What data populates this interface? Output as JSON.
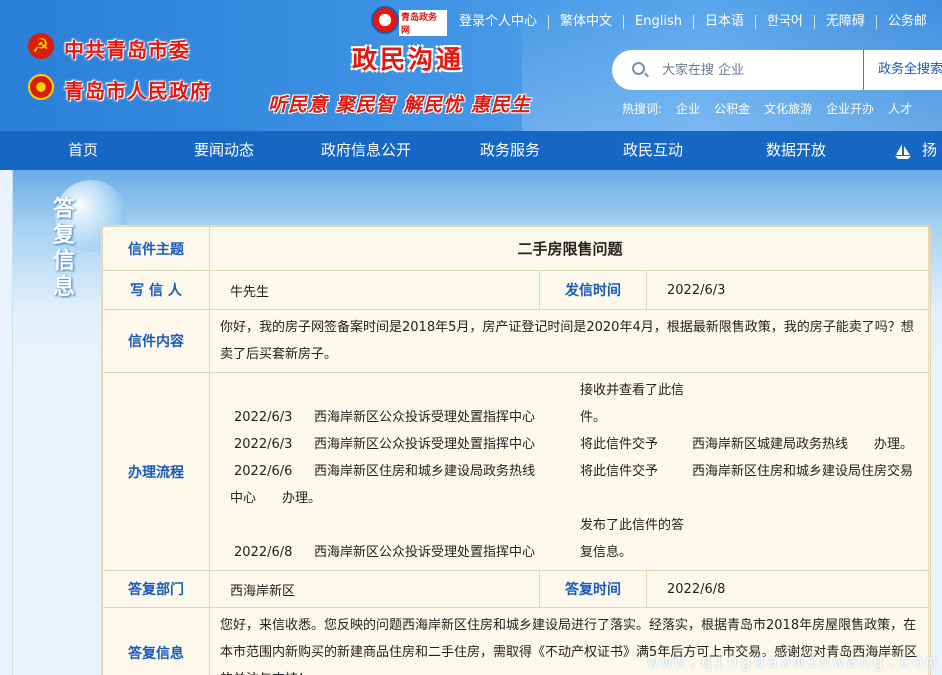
{
  "header": {
    "org_party": "中共青岛市委",
    "org_gov": "青岛市人民政府",
    "logo_text": "青岛政务网",
    "site_title": "政民沟通",
    "slogan": "听民意 聚民智 解民忧 惠民生",
    "top_links": [
      "登录个人中心",
      "繁体中文",
      "English",
      "日本语",
      "한국어",
      "无障碍",
      "公务邮"
    ],
    "search": {
      "placeholder": "大家在搜 企业",
      "button": "政务全搜索"
    },
    "hot_label": "热搜词:",
    "hot_words": [
      "企业",
      "公积金",
      "文化旅游",
      "企业开办",
      "人才"
    ]
  },
  "nav": {
    "items": [
      "首页",
      "要闻动态",
      "政府信息公开",
      "政务服务",
      "政民互动",
      "数据开放",
      "扬帆"
    ]
  },
  "side_title": "答复信息",
  "letter": {
    "subject_label": "信件主题",
    "subject": "二手房限售问题",
    "writer_label": "写 信 人",
    "writer": "牛先生",
    "sent_label": "发信时间",
    "sent_date": "2022/6/3",
    "content_label": "信件内容",
    "content": "你好，我的房子网签备案时间是2018年5月，房产证登记时间是2020年4月，根据最新限售政策，我的房子能卖了吗？想卖了后买套新房子。",
    "process_label": "办理流程",
    "process": [
      {
        "date": "2022/6/3",
        "org": "西海岸新区公众投诉受理处置指挥中心",
        "action": "接收并查看了此信件。",
        "target": ""
      },
      {
        "date": "2022/6/3",
        "org": "西海岸新区公众投诉受理处置指挥中心",
        "action": "将此信件交予",
        "target": "西海岸新区城建局政务热线　　办理。"
      },
      {
        "date": "2022/6/6",
        "org": "西海岸新区住房和城乡建设局政务热线",
        "action": "将此信件交予",
        "target": "西海岸新区住房和城乡建设局住房交易中心　　办理。"
      },
      {
        "date": "2022/6/8",
        "org": "西海岸新区公众投诉受理处置指挥中心",
        "action": "发布了此信件的答复信息。",
        "target": ""
      }
    ],
    "reply_dept_label": "答复部门",
    "reply_dept": "西海岸新区",
    "reply_time_label": "答复时间",
    "reply_date": "2022/6/8",
    "reply_label": "答复信息",
    "reply": "您好，来信收悉。您反映的问题西海岸新区住房和城乡建设局进行了落实。经落实，根据青岛市2018年房屋限售政策，在本市范围内新购买的新建商品住房和二手住房，需取得《不动产权证书》满5年后方可上市交易。感谢您对青岛西海岸新区的关注与支持！"
  },
  "watermark": "www.qingdaominwang.com"
}
